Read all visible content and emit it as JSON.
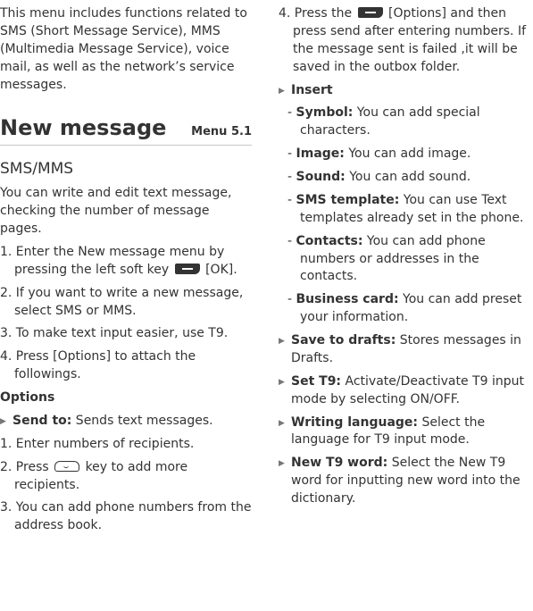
{
  "intro": "This menu includes functions related to SMS (Short Message Service), MMS (Multimedia Message Service), voice mail, as well as the network’s service messages.",
  "heading": {
    "title": "New message",
    "menu": "Menu 5.1"
  },
  "subheading": "SMS/MMS",
  "description": "You can write and edit text message, checking the number of message pages.",
  "steps": [
    {
      "pre": "1. Enter the New message menu by pressing the left soft key",
      "icon": "left-soft-key-icon",
      "post": "[OK]."
    },
    {
      "text": "2. If you want to write a new message, select SMS or MMS."
    },
    {
      "text": "3. To make text input easier, use T9."
    },
    {
      "text": "4. Press [Options] to attach the followings."
    }
  ],
  "options_title": "Options",
  "send_to": {
    "label": "Send to:",
    "text": " Sends text messages."
  },
  "send_steps": [
    {
      "text": "1. Enter numbers of recipients."
    },
    {
      "pre": "2. Press",
      "icon": "ok-key-icon",
      "post": "key to add more recipients."
    },
    {
      "text": "3. You can add phone numbers from the address book."
    },
    {
      "pre": "4. Press the",
      "icon": "left-soft-key-icon",
      "post": "[Options] and then press send after entering numbers. If the message sent is failed ,it will be saved in the outbox folder."
    }
  ],
  "insert_label": "Insert",
  "insert_items": [
    {
      "label": "Symbol:",
      "text": " You can add special characters."
    },
    {
      "label": "Image:",
      "text": " You can add image."
    },
    {
      "label": "Sound:",
      "text": " You can add sound."
    },
    {
      "label": "SMS template:",
      "text": " You can use Text templates already set in the phone."
    },
    {
      "label": "Contacts:",
      "text": " You can add phone numbers or addresses in the contacts."
    },
    {
      "label": "Business card:",
      "text": " You can add preset your information."
    }
  ],
  "more_options": [
    {
      "label": "Save to drafts:",
      "text": " Stores messages in Drafts."
    },
    {
      "label": "Set T9:",
      "text": " Activate/Deactivate T9 input mode by selecting ON/OFF."
    },
    {
      "label": "Writing language:",
      "text": " Select the language for T9 input mode."
    },
    {
      "label": "New T9 word:",
      "text": " Select the New T9 word for inputting new word into the dictionary."
    }
  ]
}
